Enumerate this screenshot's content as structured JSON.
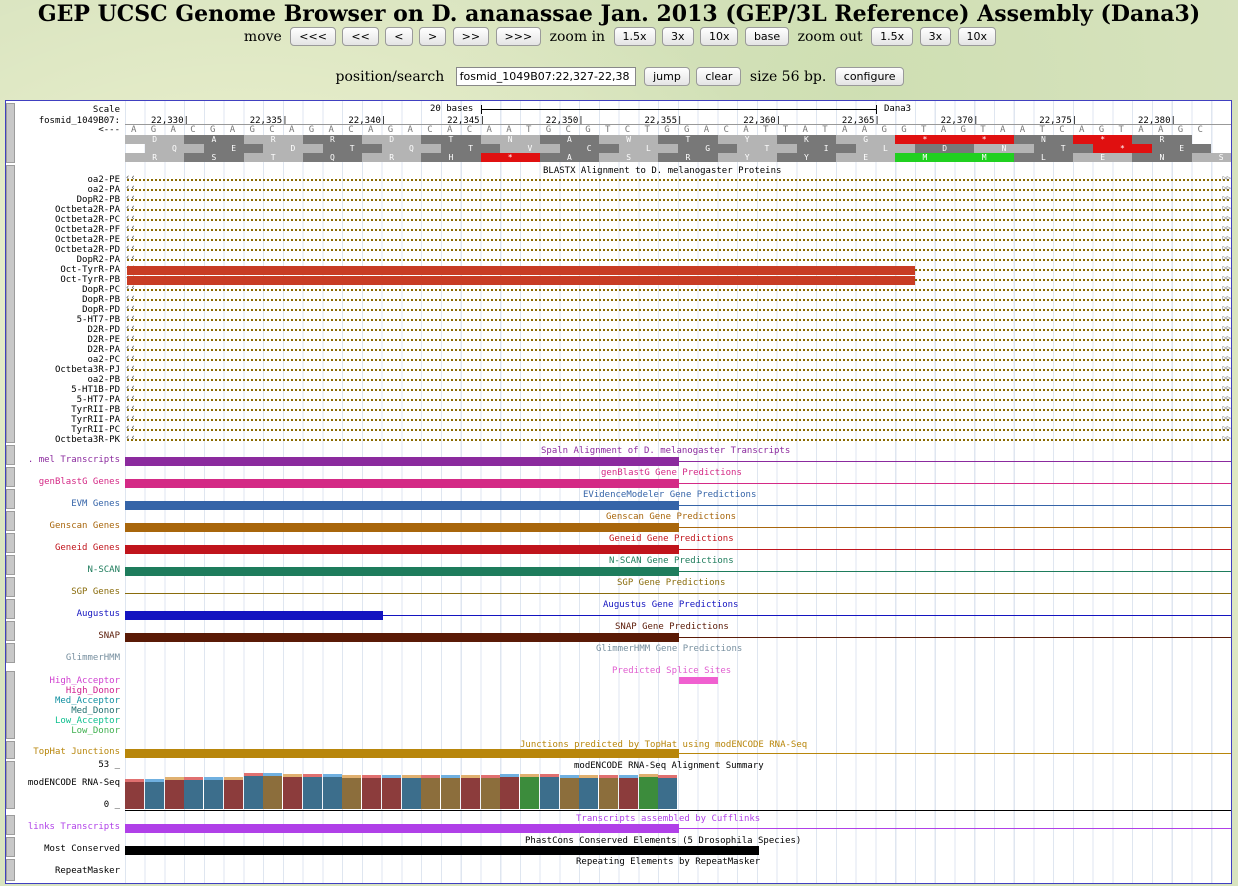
{
  "header": {
    "title": "GEP UCSC Genome Browser on D. ananassae Jan. 2013 (GEP/3L Reference) Assembly (Dana3)"
  },
  "nav": {
    "move_label": "move",
    "move_buttons": [
      "<<<",
      "<<",
      "<",
      ">",
      ">>",
      ">>>"
    ],
    "zoom_in_label": "zoom in",
    "zoom_in_buttons": [
      "1.5x",
      "3x",
      "10x",
      "base"
    ],
    "zoom_out_label": "zoom out",
    "zoom_out_buttons": [
      "1.5x",
      "3x",
      "10x"
    ],
    "position_label": "position/search",
    "position_value": "fosmid_1049B07:22,327-22,38",
    "jump_label": "jump",
    "clear_label": "clear",
    "size_text": "size 56 bp.",
    "configure_label": "configure"
  },
  "ruler": {
    "scale_label": "Scale",
    "scale_text": "20 bases",
    "assembly": "Dana3",
    "chrom_label": "fosmid_1049B07:",
    "strand_label": "<---",
    "ticks": [
      "22,330|",
      "22,335|",
      "22,340|",
      "22,345|",
      "22,350|",
      "22,355|",
      "22,360|",
      "22,365|",
      "22,370|",
      "22,375|",
      "22,380|"
    ],
    "bases": "AGACGAGCAGACAGACACAATGCGTCTGGACATTATAAGGTAGTAATCAGTAAGC",
    "frame1": [
      "D",
      "A",
      "R",
      "R",
      "D",
      "T",
      "N",
      "A",
      "W",
      "T",
      "Y",
      "K",
      "G",
      "*",
      "*",
      "N",
      "*",
      "R"
    ],
    "frame2": [
      "Q",
      "E",
      "D",
      "T",
      "Q",
      "T",
      "V",
      "C",
      "L",
      "G",
      "T",
      "I",
      "L",
      "D",
      "N",
      "T",
      "*",
      "E"
    ],
    "frame3": [
      "R",
      "S",
      "T",
      "Q",
      "R",
      "H",
      "*",
      "A",
      "S",
      "R",
      "Y",
      "Y",
      "E",
      "M",
      "M",
      "L",
      "E",
      "N",
      "S"
    ]
  },
  "blastx": {
    "title": "BLASTX Alignment to D. melanogaster Proteins",
    "rows": [
      "oa2-PE",
      "oa2-PA",
      "DopR2-PB",
      "Octbeta2R-PA",
      "Octbeta2R-PC",
      "Octbeta2R-PF",
      "Octbeta2R-PE",
      "Octbeta2R-PD",
      "DopR2-PA",
      "Oct-TyrR-PA",
      "Oct-TyrR-PB",
      "DopR-PC",
      "DopR-PB",
      "DopR-PD",
      "5-HT7-PB",
      "D2R-PD",
      "D2R-PE",
      "D2R-PA",
      "oa2-PC",
      "Octbeta3R-PJ",
      "oa2-PB",
      "5-HT1B-PD",
      "5-HT7-PA",
      "TyrRII-PB",
      "TyrRII-PA",
      "TyrRII-PC",
      "Octbeta3R-PK"
    ]
  },
  "tracks": [
    {
      "label": ". mel Transcripts",
      "title": "Spaln Alignment of D. melanogaster Transcripts",
      "color": "#8b2a9e"
    },
    {
      "label": "genBlastG Genes",
      "title": "genBlastG Gene Predictions",
      "color": "#d42a86"
    },
    {
      "label": "EVM Genes",
      "title": "EVidenceModeler Gene Predictions",
      "color": "#3564a8"
    },
    {
      "label": "Genscan Genes",
      "title": "Genscan Gene Predictions",
      "color": "#a8660c"
    },
    {
      "label": "Geneid Genes",
      "title": "Geneid Gene Predictions",
      "color": "#c0141c"
    },
    {
      "label": "N-SCAN",
      "title": "N-SCAN Gene Predictions",
      "color": "#1e7c5c"
    },
    {
      "label": "SGP Genes",
      "title": "SGP Gene Predictions",
      "color": "#8a6c0c"
    },
    {
      "label": "Augustus",
      "title": "Augustus Gene Predictions",
      "color": "#1414c0"
    },
    {
      "label": "SNAP",
      "title": "SNAP Gene Predictions",
      "color": "#5a1a06"
    },
    {
      "label": "GlimmerHMM",
      "title": "GlimmerHMM Gene Predictions",
      "color": "#7890a0"
    }
  ],
  "splice": {
    "title": "Predicted Splice Sites",
    "labels": [
      {
        "text": "High_Acceptor",
        "color": "#d040d0"
      },
      {
        "text": "High_Donor",
        "color": "#d02090"
      },
      {
        "text": "Med_Acceptor",
        "color": "#1090a0"
      },
      {
        "text": "Med_Donor",
        "color": "#207070"
      },
      {
        "text": "Low_Acceptor",
        "color": "#10c090"
      },
      {
        "text": "Low_Donor",
        "color": "#40b050"
      }
    ],
    "color": "#f060d0"
  },
  "tophat": {
    "label": "TopHat Junctions",
    "title": "Junctions predicted by TopHat using modENCODE RNA-Seq",
    "color": "#b8860b"
  },
  "rnaseq": {
    "label": "modENCODE RNA-Seq",
    "title": "modENCODE RNA-Seq Alignment Summary",
    "max": "53 _",
    "min": "0 _"
  },
  "cufflinks": {
    "label": "links Transcripts",
    "title": "Transcripts assembled by Cufflinks",
    "color": "#b040e8"
  },
  "phastcons": {
    "label": "Most Conserved",
    "title": "PhastCons Conserved Elements (5 Drosophila Species)",
    "color": "#000000"
  },
  "repeat": {
    "label": "RepeatMasker",
    "title": "Repeating Elements by RepeatMasker"
  }
}
